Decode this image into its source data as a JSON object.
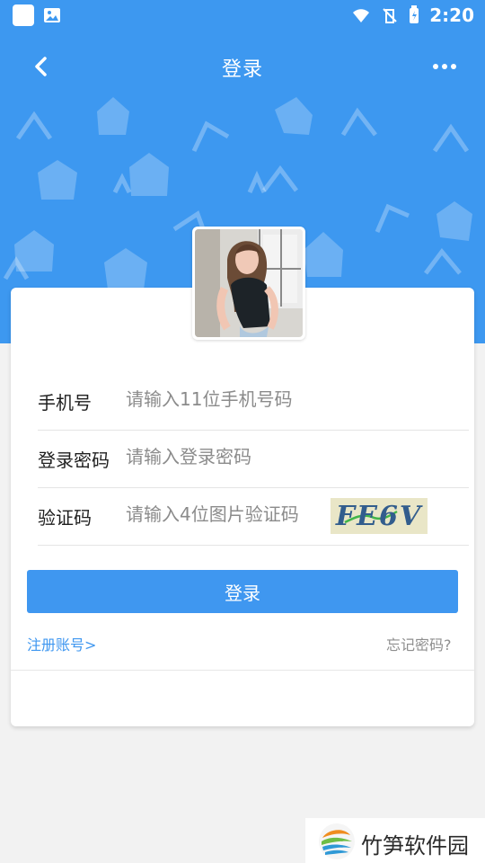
{
  "status_bar": {
    "time": "2:20",
    "icons": [
      "app-square-icon",
      "image-icon",
      "wifi-icon",
      "signal-off-icon",
      "battery-charging-icon"
    ]
  },
  "header": {
    "title": "登录"
  },
  "form": {
    "phone": {
      "label": "手机号",
      "placeholder": "请输入11位手机号码"
    },
    "password": {
      "label": "登录密码",
      "placeholder": "请输入登录密码"
    },
    "captcha": {
      "label": "验证码",
      "placeholder": "请输入4位图片验证码",
      "image_text": "FE6V"
    },
    "login_button": "登录",
    "register_link": "注册账号>",
    "forgot_link": "忘记密码?"
  },
  "watermark": {
    "text": "竹笋软件园"
  },
  "colors": {
    "primary": "#3f97f0",
    "background": "#f2f2f2"
  }
}
